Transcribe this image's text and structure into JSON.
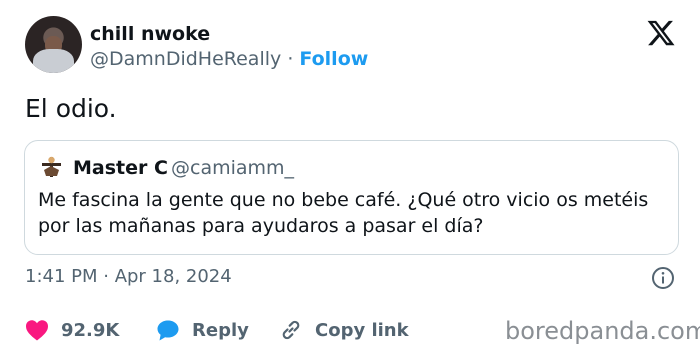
{
  "author": {
    "name": "chill nwoke",
    "handle": "@DamnDidHeReally",
    "separator": "·",
    "follow_label": "Follow"
  },
  "tweet": {
    "text": "El odio."
  },
  "quoted_tweet": {
    "name": "Master C",
    "handle": "@camiamm_",
    "text": "Me fascina la gente que no bebe café. ¿Qué otro vicio os metéis por las mañanas para ayudaros a pasar el día?"
  },
  "meta": {
    "timestamp": "1:41 PM · Apr 18, 2024"
  },
  "actions": {
    "likes": "92.9K",
    "reply_label": "Reply",
    "copy_link_label": "Copy link"
  },
  "watermark": "boredpanda.com",
  "icons": {
    "brand": "x-logo-icon",
    "like": "heart-icon",
    "reply": "reply-bubble-icon",
    "copy": "link-icon",
    "info": "info-icon"
  },
  "colors": {
    "text_primary": "#0f1419",
    "text_secondary": "#536471",
    "link_blue": "#1d9bf0",
    "like_pink": "#f91880",
    "border": "#cfd9de"
  }
}
